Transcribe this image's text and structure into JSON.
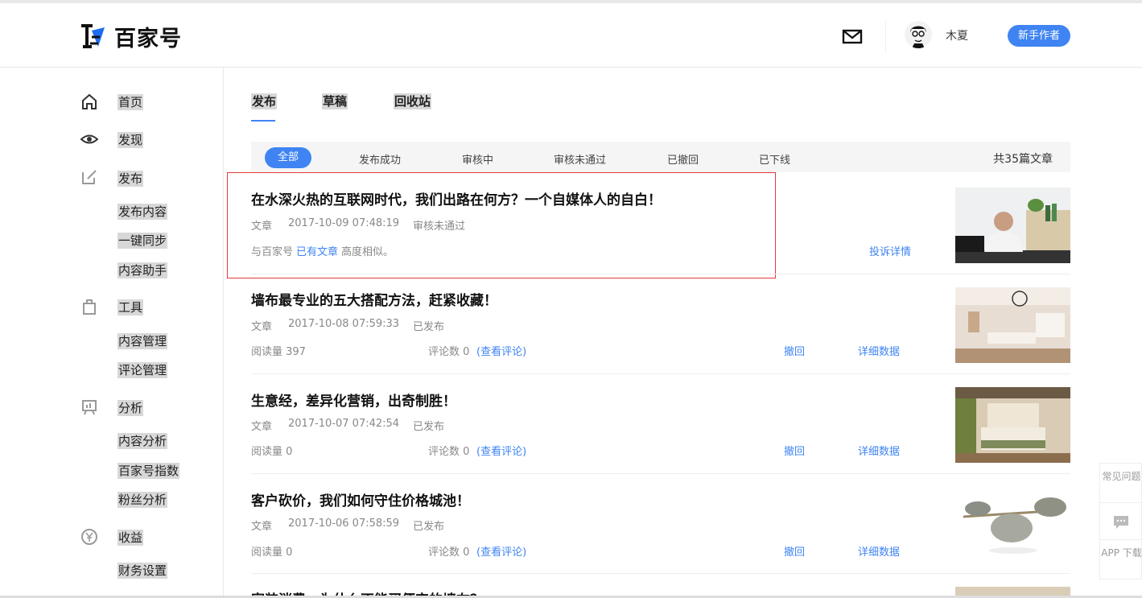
{
  "brand": {
    "name": "百家号"
  },
  "header": {
    "username": "木夏",
    "badge": "新手作者"
  },
  "sidebar": {
    "home": "首页",
    "discover": "发现",
    "publish": "发布",
    "publish_content": "发布内容",
    "sync": "一键同步",
    "assistant": "内容助手",
    "tools": "工具",
    "content_mgmt": "内容管理",
    "comment_mgmt": "评论管理",
    "analytics": "分析",
    "content_analytics": "内容分析",
    "bjh_index": "百家号指数",
    "fans_analytics": "粉丝分析",
    "income": "收益",
    "finance": "财务设置"
  },
  "tabs": [
    "发布",
    "草稿",
    "回收站"
  ],
  "filters": {
    "all": "全部",
    "items": [
      "发布成功",
      "审核中",
      "审核未通过",
      "已撤回",
      "已下线"
    ],
    "total": "共35篇文章"
  },
  "articles": [
    {
      "title": "在水深火热的互联网时代，我们出路在何方？一个自媒体人的自白！",
      "type": "文章",
      "time": "2017-10-09 07:48:19",
      "status": "审核未通过",
      "note_pre": "与百家号",
      "note_link": "已有文章",
      "note_post": "高度相似。",
      "complaint": "投诉详情"
    },
    {
      "title": "墙布最专业的五大搭配方法，赶紧收藏！",
      "type": "文章",
      "time": "2017-10-08 07:59:33",
      "status": "已发布",
      "reads": "阅读量 397",
      "comments": "评论数 0",
      "view_comments": "(查看评论)",
      "withdraw": "撤回",
      "details": "详细数据"
    },
    {
      "title": "生意经，差异化营销，出奇制胜！",
      "type": "文章",
      "time": "2017-10-07 07:42:54",
      "status": "已发布",
      "reads": "阅读量 0",
      "comments": "评论数 0",
      "view_comments": "(查看评论)",
      "withdraw": "撤回",
      "details": "详细数据"
    },
    {
      "title": "客户砍价，我们如何守住价格城池！",
      "type": "文章",
      "time": "2017-10-06 07:58:59",
      "status": "已发布",
      "reads": "阅读量 0",
      "comments": "评论数 0",
      "view_comments": "(查看评论)",
      "withdraw": "撤回",
      "details": "详细数据"
    },
    {
      "title": "家装消费，为什么不能买便宜的墙布？"
    }
  ],
  "float": {
    "faq": "常见问题",
    "app": "APP 下载"
  },
  "colors": {
    "accent": "#3f84f2",
    "highlight_border": "#e4393c"
  }
}
